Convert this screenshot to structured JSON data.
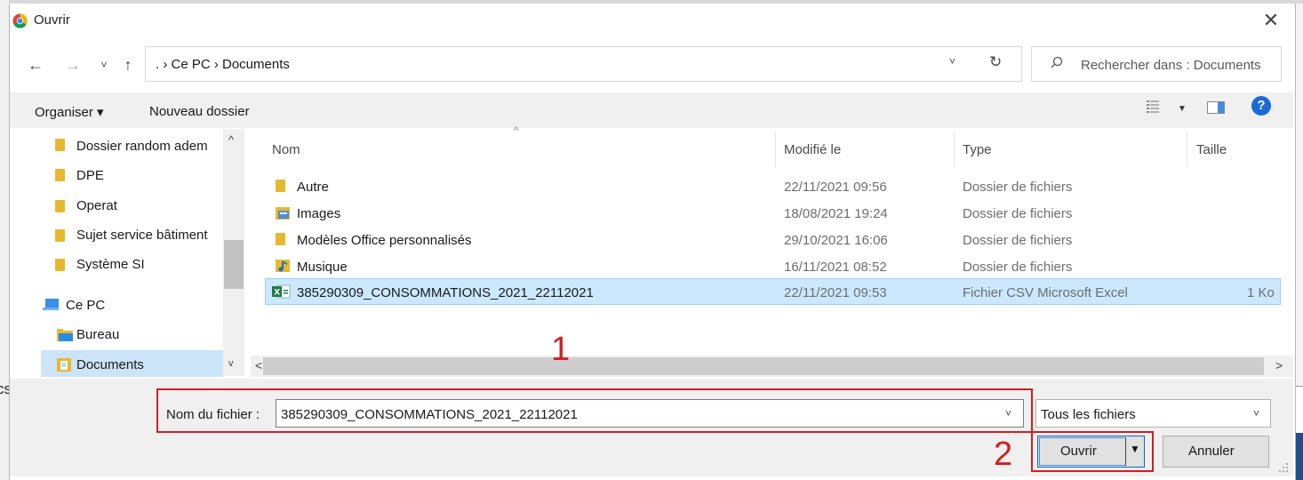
{
  "window": {
    "title": "Ouvrir"
  },
  "stray_text": "cs",
  "nav": {
    "back": "←",
    "forward": "→",
    "recent": "˅",
    "up": "↑",
    "address": ". › Ce PC › Documents",
    "address_dropdown": "˅",
    "refresh": "↻",
    "search_placeholder": "Rechercher dans : Documents"
  },
  "toolbar": {
    "organize": "Organiser ▾",
    "new_folder": "Nouveau dossier",
    "view_caret": "▼",
    "help": "?"
  },
  "sidebar": {
    "items": [
      {
        "label": "Dossier random adem",
        "icon": "folder-icon"
      },
      {
        "label": "DPE",
        "icon": "folder-icon"
      },
      {
        "label": "Operat",
        "icon": "folder-icon"
      },
      {
        "label": "Sujet service bâtiment",
        "icon": "folder-icon"
      },
      {
        "label": "Système SI",
        "icon": "folder-icon"
      },
      {
        "label": "Ce PC",
        "icon": "pc-icon"
      },
      {
        "label": "Bureau",
        "icon": "desktop-folder-icon"
      },
      {
        "label": "Documents",
        "icon": "documents-folder-icon",
        "selected": true
      }
    ],
    "scroll_up": "^",
    "scroll_down": "v"
  },
  "files": {
    "columns": [
      "Nom",
      "Modifié le",
      "Type",
      "Taille"
    ],
    "rows": [
      {
        "name": "Autre",
        "modified": "22/11/2021 09:56",
        "type": "Dossier de fichiers",
        "size": "",
        "icon": "folder-icon"
      },
      {
        "name": "Images",
        "modified": "18/08/2021 19:24",
        "type": "Dossier de fichiers",
        "size": "",
        "icon": "pictures-folder-icon"
      },
      {
        "name": "Modèles Office personnalisés",
        "modified": "29/10/2021 16:06",
        "type": "Dossier de fichiers",
        "size": "",
        "icon": "folder-icon"
      },
      {
        "name": "Musique",
        "modified": "16/11/2021 08:52",
        "type": "Dossier de fichiers",
        "size": "",
        "icon": "music-folder-icon"
      },
      {
        "name": "385290309_CONSOMMATIONS_2021_22112021",
        "modified": "22/11/2021 09:53",
        "type": "Fichier CSV Microsoft Excel",
        "size": "1 Ko",
        "icon": "excel-csv-icon",
        "selected": true
      }
    ],
    "scroll_left": "<",
    "scroll_right": ">"
  },
  "bottom": {
    "filename_label": "Nom du fichier :",
    "filename_value": "385290309_CONSOMMATIONS_2021_22112021",
    "filter_value": "Tous les fichiers",
    "open_label": "Ouvrir",
    "open_caret": "▼",
    "cancel_label": "Annuler",
    "dropdown": "˅"
  },
  "annotations": {
    "marker_1": "1",
    "marker_2": "2"
  },
  "colors": {
    "selection": "#cce8ff",
    "annotation_red": "#d01f24",
    "folder": "#e8b730"
  }
}
